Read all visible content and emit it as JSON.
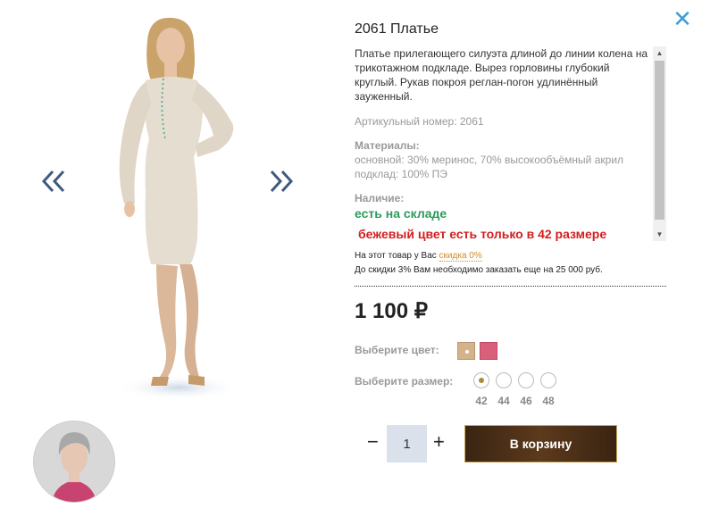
{
  "product": {
    "title": "2061 Платье",
    "description": "Платье прилегающего силуэта длиной до линии колена на трикотажном подкладе. Вырез горловины глубокий круглый. Рукав покроя реглан-погон удлинённый зауженный.",
    "article": "Артикульный номер: 2061",
    "materials_heading": "Материалы:",
    "materials_main": "основной: 30% меринос, 70% высокообъёмный акрил",
    "materials_lining": "подклад: 100% ПЭ",
    "availability_heading": "Наличие:",
    "availability_status": "есть на складе",
    "color_note": "бежевый цвет есть только в 42 размере"
  },
  "discount": {
    "line1_prefix": "На этот товар у Вас",
    "line1_link": "скидка 0%",
    "line2": "До скидки 3% Вам необходимо заказать еще на 25 000 руб."
  },
  "price": "1 100 ₽",
  "color_picker": {
    "label": "Выберите цвет:",
    "options": [
      {
        "name": "beige",
        "hex": "#d4b28a",
        "selected": true
      },
      {
        "name": "pink",
        "hex": "#d9607a",
        "selected": false
      }
    ]
  },
  "size_picker": {
    "label": "Выберите размер:",
    "sizes": [
      "42",
      "44",
      "46",
      "48"
    ],
    "selected": "42"
  },
  "cart": {
    "quantity": "1",
    "minus": "−",
    "plus": "+",
    "button_label": "В корзину"
  },
  "icons": {
    "close": "close-icon",
    "prev": "chevron-double-left-icon",
    "next": "chevron-double-right-icon"
  },
  "colors": {
    "accent_close": "#3aa0d8",
    "in_stock": "#2e9a5c",
    "warning": "#d21e1e",
    "cart_button": "#4a2e16",
    "discount_link": "#d08c2a"
  }
}
